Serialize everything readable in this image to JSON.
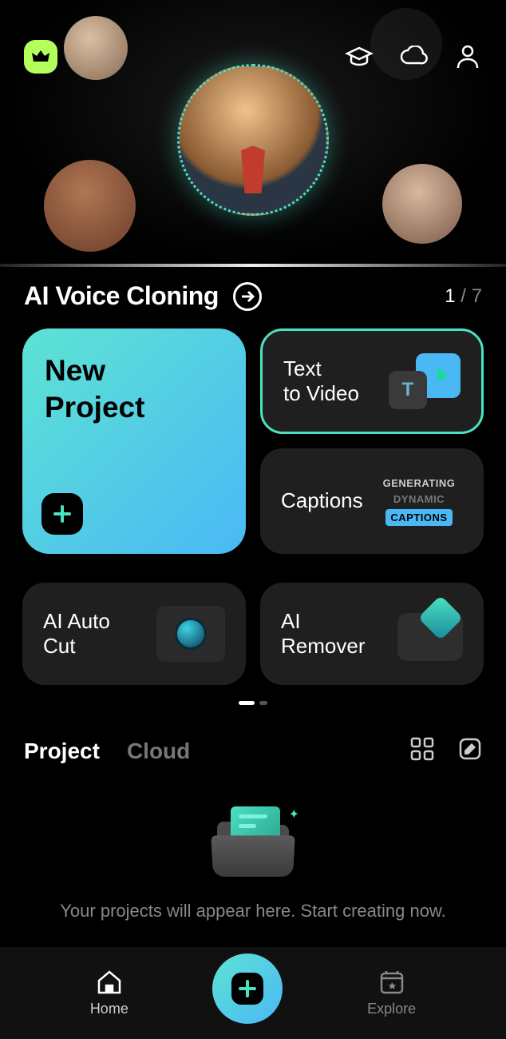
{
  "hero": {
    "feature_title": "AI Voice Cloning",
    "page_current": "1",
    "page_total": "7"
  },
  "cards": {
    "new_project": "New Project",
    "text_to_video": "Text\nto Video",
    "captions": "Captions",
    "captions_badge_1": "GENERATING",
    "captions_badge_2": "DYNAMIC",
    "captions_badge_3": "CAPTIONS",
    "ai_auto_cut": "AI Auto Cut",
    "ai_remover": "AI Remover"
  },
  "projects": {
    "tab_project": "Project",
    "tab_cloud": "Cloud",
    "empty_text": "Your projects will appear here. Start creating now."
  },
  "nav": {
    "home": "Home",
    "explore": "Explore"
  }
}
